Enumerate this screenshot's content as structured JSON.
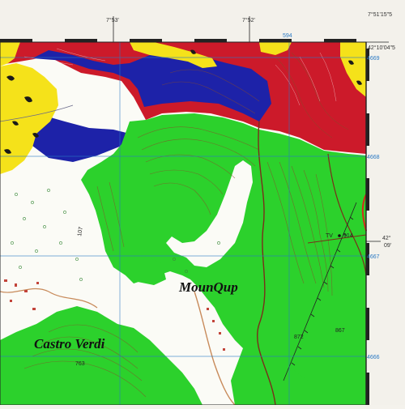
{
  "map": {
    "labels": {
      "castro_verdi": "Castro Verdi",
      "mounqup": "MounQup"
    },
    "graticule": {
      "top_lon_1": "7°53'",
      "top_lon_2": "7°52'",
      "corner_lon": "7°51'15\"5",
      "corner_lat": "42°10'04\"5",
      "right_lat_deg": "42°",
      "right_lat_min": "09'"
    },
    "grid": {
      "easting_594": "594",
      "northing_4669": "4669",
      "northing_4668": "4668",
      "northing_4667": "4667",
      "northing_4666": "4666"
    },
    "spot_heights": {
      "h914": "914",
      "h872": "872",
      "h867": "867",
      "h763": "763",
      "road_label": "107",
      "tv": "TV"
    },
    "colors": {
      "forest_green": "#2cd12c",
      "red_zone": "#cc1a2a",
      "blue_zone": "#1d22a8",
      "yellow_zone": "#f5e21a",
      "grid_blue": "#2a79c4",
      "contour_brown": "#8a4a2a",
      "road_brown": "#7a2e1a"
    }
  }
}
